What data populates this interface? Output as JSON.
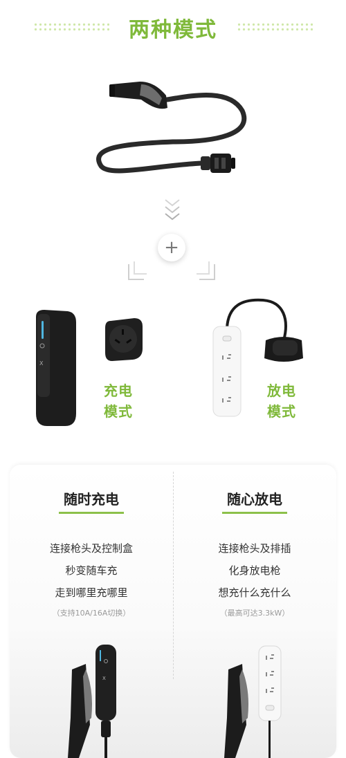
{
  "title": "两种模式",
  "modes": {
    "charge": {
      "line1": "充电",
      "line2": "模式"
    },
    "discharge": {
      "line1": "放电",
      "line2": "模式"
    }
  },
  "plus_symbol": "+",
  "cards": {
    "left": {
      "title": "随时充电",
      "lines": [
        "连接枪头及控制盒",
        "秒变随车充",
        "走到哪里充哪里"
      ],
      "note": "（支持10A/16A切换）"
    },
    "right": {
      "title": "随心放电",
      "lines": [
        "连接枪头及排插",
        "化身放电枪",
        "想充什么充什么"
      ],
      "note": "（最高可达3.3kW）"
    }
  },
  "colors": {
    "accent": "#7fb93a",
    "bar": "#8cc04a"
  }
}
